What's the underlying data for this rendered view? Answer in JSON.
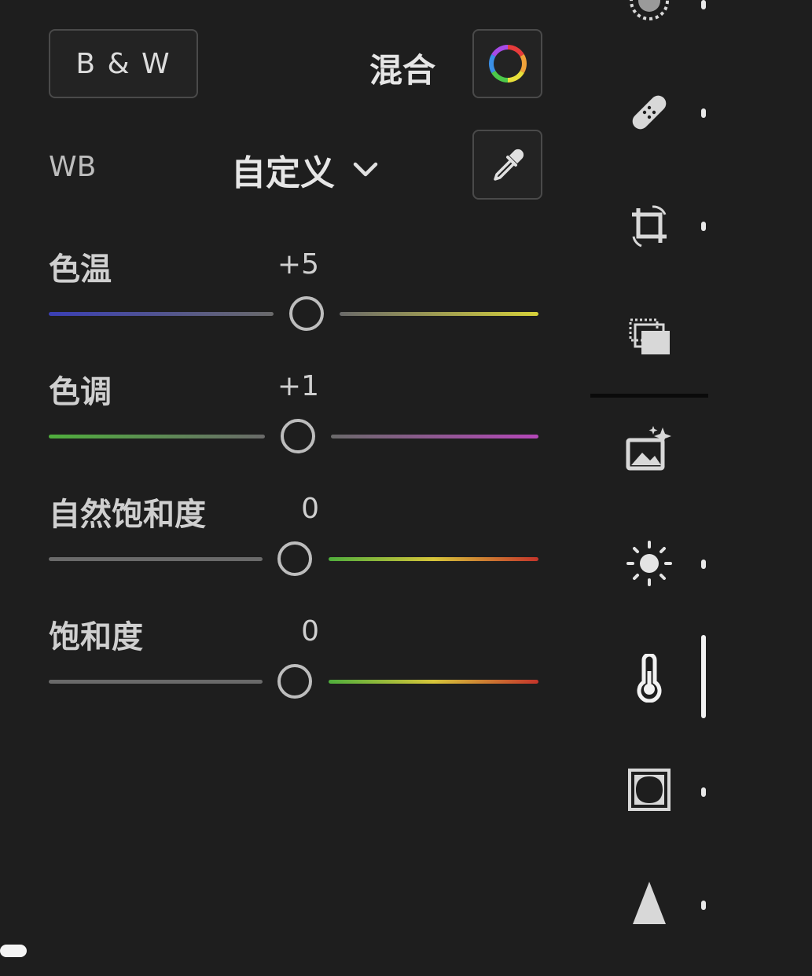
{
  "header": {
    "bw_label": "B & W",
    "mix_label": "混合"
  },
  "white_balance": {
    "label": "WB",
    "selected": "自定义"
  },
  "sliders": [
    {
      "label": "色温",
      "value": "+5",
      "colors": [
        "#3a3fb5",
        "#d6d13a"
      ]
    },
    {
      "label": "色调",
      "value": "+1",
      "colors": [
        "#4fae3c",
        "#b447b8"
      ]
    },
    {
      "label": "自然饱和度",
      "value": "0",
      "colors": [
        "#6a6a6a",
        "#c4342a"
      ]
    },
    {
      "label": "饱和度",
      "value": "0",
      "colors": [
        "#6a6a6a",
        "#c4342a"
      ]
    }
  ],
  "rail": {
    "icons": [
      "masking-icon",
      "healing-icon",
      "crop-icon",
      "presets-icon",
      "auto-enhance-icon",
      "light-icon",
      "color-icon",
      "effects-icon",
      "detail-icon"
    ],
    "active": "color-icon"
  }
}
